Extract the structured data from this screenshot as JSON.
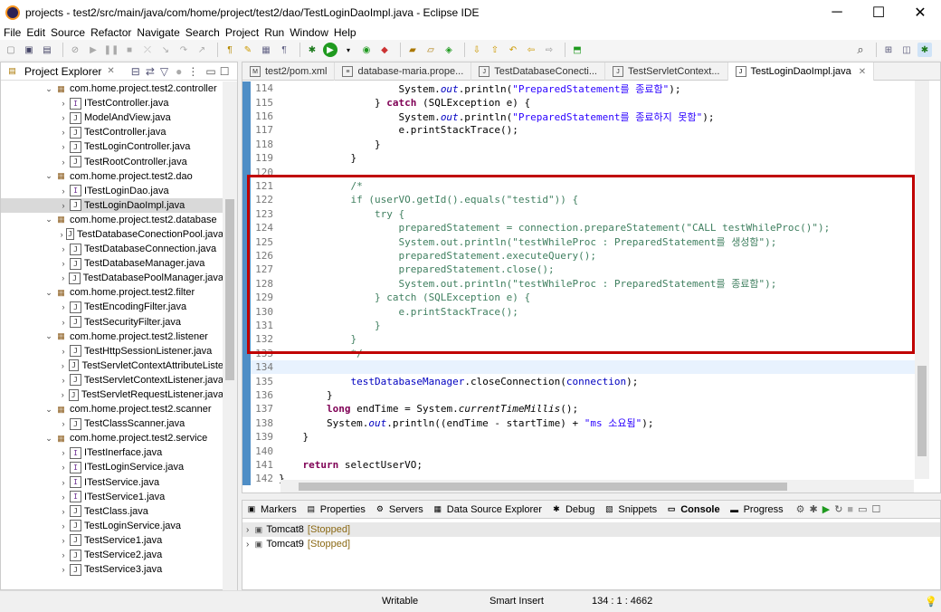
{
  "window": {
    "title": "projects - test2/src/main/java/com/home/project/test2/dao/TestLoginDaoImpl.java - Eclipse IDE",
    "minimize": "─",
    "maximize": "☐",
    "close": "✕"
  },
  "menu": [
    "File",
    "Edit",
    "Source",
    "Refactor",
    "Navigate",
    "Search",
    "Project",
    "Run",
    "Window",
    "Help"
  ],
  "project_explorer": {
    "title": "Project Explorer",
    "items": [
      {
        "type": "package",
        "label": "com.home.project.test2.controller",
        "indent": 0,
        "expanded": true
      },
      {
        "type": "interface",
        "label": "ITestController.java",
        "indent": 1
      },
      {
        "type": "java",
        "label": "ModelAndView.java",
        "indent": 1
      },
      {
        "type": "java",
        "label": "TestController.java",
        "indent": 1
      },
      {
        "type": "java",
        "label": "TestLoginController.java",
        "indent": 1
      },
      {
        "type": "java",
        "label": "TestRootController.java",
        "indent": 1
      },
      {
        "type": "package",
        "label": "com.home.project.test2.dao",
        "indent": 0,
        "expanded": true
      },
      {
        "type": "interface",
        "label": "ITestLoginDao.java",
        "indent": 1
      },
      {
        "type": "java",
        "label": "TestLoginDaoImpl.java",
        "indent": 1,
        "selected": true
      },
      {
        "type": "package",
        "label": "com.home.project.test2.database",
        "indent": 0,
        "expanded": true
      },
      {
        "type": "java",
        "label": "TestDatabaseConectionPool.java",
        "indent": 1
      },
      {
        "type": "java",
        "label": "TestDatabaseConnection.java",
        "indent": 1
      },
      {
        "type": "java",
        "label": "TestDatabaseManager.java",
        "indent": 1
      },
      {
        "type": "java",
        "label": "TestDatabasePoolManager.java",
        "indent": 1
      },
      {
        "type": "package",
        "label": "com.home.project.test2.filter",
        "indent": 0,
        "expanded": true
      },
      {
        "type": "java",
        "label": "TestEncodingFilter.java",
        "indent": 1
      },
      {
        "type": "java",
        "label": "TestSecurityFilter.java",
        "indent": 1
      },
      {
        "type": "package",
        "label": "com.home.project.test2.listener",
        "indent": 0,
        "expanded": true
      },
      {
        "type": "java",
        "label": "TestHttpSessionListener.java",
        "indent": 1
      },
      {
        "type": "java",
        "label": "TestServletContextAttributeListe",
        "indent": 1
      },
      {
        "type": "java",
        "label": "TestServletContextListener.java",
        "indent": 1
      },
      {
        "type": "java",
        "label": "TestServletRequestListener.java",
        "indent": 1
      },
      {
        "type": "package",
        "label": "com.home.project.test2.scanner",
        "indent": 0,
        "expanded": true
      },
      {
        "type": "java",
        "label": "TestClassScanner.java",
        "indent": 1
      },
      {
        "type": "package",
        "label": "com.home.project.test2.service",
        "indent": 0,
        "expanded": true
      },
      {
        "type": "interface",
        "label": "ITestInerface.java",
        "indent": 1
      },
      {
        "type": "interface",
        "label": "ITestLoginService.java",
        "indent": 1
      },
      {
        "type": "interface",
        "label": "ITestService.java",
        "indent": 1
      },
      {
        "type": "interface",
        "label": "ITestService1.java",
        "indent": 1
      },
      {
        "type": "java",
        "label": "TestClass.java",
        "indent": 1
      },
      {
        "type": "java",
        "label": "TestLoginService.java",
        "indent": 1
      },
      {
        "type": "java",
        "label": "TestService1.java",
        "indent": 1
      },
      {
        "type": "java",
        "label": "TestService2.java",
        "indent": 1
      },
      {
        "type": "java",
        "label": "TestService3.java",
        "indent": 1
      }
    ]
  },
  "editor_tabs": [
    {
      "label": "test2/pom.xml",
      "icon": "M",
      "active": false
    },
    {
      "label": "database-maria.prope...",
      "icon": "≡",
      "active": false
    },
    {
      "label": "TestDatabaseConecti...",
      "icon": "J",
      "active": false
    },
    {
      "label": "TestServletContext...",
      "icon": "J",
      "active": false
    },
    {
      "label": "TestLoginDaoImpl.java",
      "icon": "J",
      "active": true
    }
  ],
  "code_lines": [
    {
      "no": "114",
      "html": "                    System.<span class=\"fld ital\">out</span>.println(<span class=\"str\">\"PreparedStatement를 종료함\"</span>);"
    },
    {
      "no": "115",
      "html": "                } <span class=\"kw\">catch</span> (SQLException e) {"
    },
    {
      "no": "116",
      "html": "                    System.<span class=\"fld ital\">out</span>.println(<span class=\"str\">\"PreparedStatement를 종료하지 못함\"</span>);"
    },
    {
      "no": "117",
      "html": "                    e.printStackTrace();"
    },
    {
      "no": "118",
      "html": "                }"
    },
    {
      "no": "119",
      "html": "            }"
    },
    {
      "no": "120",
      "html": ""
    },
    {
      "no": "121",
      "html": "<span class=\"cm\">            /*</span>"
    },
    {
      "no": "122",
      "html": "<span class=\"cm\">            if (userVO.getId().equals(\"testid\")) {</span>"
    },
    {
      "no": "123",
      "html": "<span class=\"cm\">                try {</span>"
    },
    {
      "no": "124",
      "html": "<span class=\"cm\">                    preparedStatement = connection.prepareStatement(\"CALL testWhileProc()\");</span>"
    },
    {
      "no": "125",
      "html": "<span class=\"cm\">                    System.out.println(\"testWhileProc : PreparedStatement를 생성함\");</span>"
    },
    {
      "no": "126",
      "html": "<span class=\"cm\">                    preparedStatement.executeQuery();</span>"
    },
    {
      "no": "127",
      "html": "<span class=\"cm\">                    preparedStatement.close();</span>"
    },
    {
      "no": "128",
      "html": "<span class=\"cm\">                    System.out.println(\"testWhileProc : PreparedStatement를 종료함\");</span>"
    },
    {
      "no": "129",
      "html": "<span class=\"cm\">                } catch (SQLException e) {</span>"
    },
    {
      "no": "130",
      "html": "<span class=\"cm\">                    e.printStackTrace();</span>"
    },
    {
      "no": "131",
      "html": "<span class=\"cm\">                }</span>"
    },
    {
      "no": "132",
      "html": "<span class=\"cm\">            }</span>"
    },
    {
      "no": "133",
      "html": "<span class=\"cm\">            */</span>"
    },
    {
      "no": "134",
      "html": "",
      "current": true
    },
    {
      "no": "135",
      "html": "            <span class=\"fld\">testDatabaseManager</span>.closeConnection(<span class=\"fld\">connection</span>);"
    },
    {
      "no": "136",
      "html": "        }"
    },
    {
      "no": "137",
      "html": "        <span class=\"kw\">long</span> endTime = System.<span class=\"ital\">currentTimeMillis</span>();"
    },
    {
      "no": "138",
      "html": "        System.<span class=\"fld ital\">out</span>.println((endTime - startTime) + <span class=\"str\">\"ms 소요됨\"</span>);"
    },
    {
      "no": "139",
      "html": "    }"
    },
    {
      "no": "140",
      "html": ""
    },
    {
      "no": "141",
      "html": "    <span class=\"kw\">return</span> selectUserVO;"
    },
    {
      "no": "142",
      "html": "}"
    }
  ],
  "bottom_tabs": [
    {
      "label": "Markers",
      "icon": "▣",
      "active": false
    },
    {
      "label": "Properties",
      "icon": "▤",
      "active": false
    },
    {
      "label": "Servers",
      "icon": "⚙",
      "active": false
    },
    {
      "label": "Data Source Explorer",
      "icon": "▦",
      "active": false
    },
    {
      "label": "Debug",
      "icon": "✱",
      "active": false
    },
    {
      "label": "Snippets",
      "icon": "▧",
      "active": false
    },
    {
      "label": "Console",
      "icon": "▭",
      "active": true
    },
    {
      "label": "Progress",
      "icon": "▬",
      "active": false
    }
  ],
  "servers": [
    {
      "name": "Tomcat8",
      "status": "[Stopped]"
    },
    {
      "name": "Tomcat9",
      "status": "[Stopped]"
    }
  ],
  "status": {
    "writable": "Writable",
    "insert_mode": "Smart Insert",
    "position": "134 : 1 : 4662"
  },
  "colors": {
    "keyword": "#7f0055",
    "string": "#2a00ff",
    "comment": "#3f7f5f",
    "field": "#0000c0",
    "highlight_box": "#c00000"
  }
}
